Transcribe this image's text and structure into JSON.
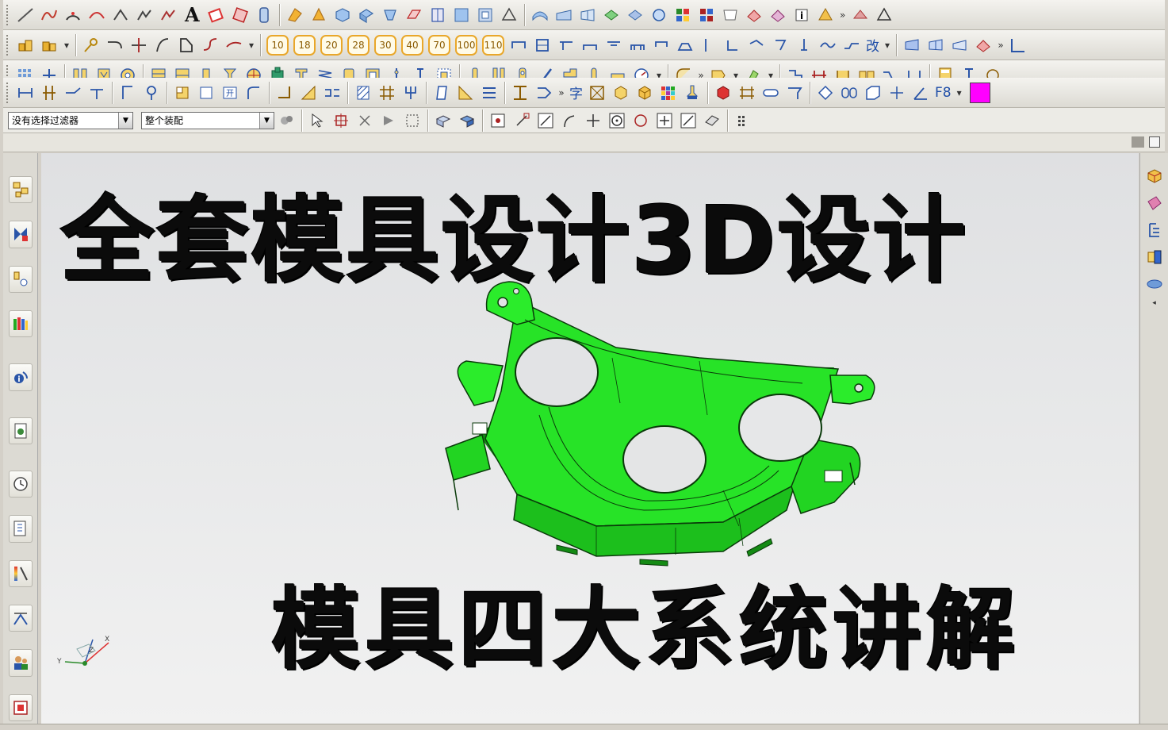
{
  "filter": {
    "selection_filter": "没有选择过滤器",
    "assembly_scope": "整个装配"
  },
  "toolbar": {
    "text_tool_glyph": "A",
    "number_buttons": [
      "10",
      "18",
      "20",
      "28",
      "30",
      "40",
      "70",
      "100",
      "110"
    ],
    "edit_char": "改",
    "char_tool": "字",
    "open_char": "开",
    "f8_label": "F8"
  },
  "overlay": {
    "headline_1": "全套模具设计3D设计",
    "headline_2": "模具四大系统讲解"
  },
  "model": {
    "part_color": "#1fe01f",
    "edge_color": "#0a3a0a",
    "color_swatch": "#ff00ff"
  },
  "triad": {
    "x_label": "X",
    "y_label": "Y",
    "z_label": "Z"
  }
}
